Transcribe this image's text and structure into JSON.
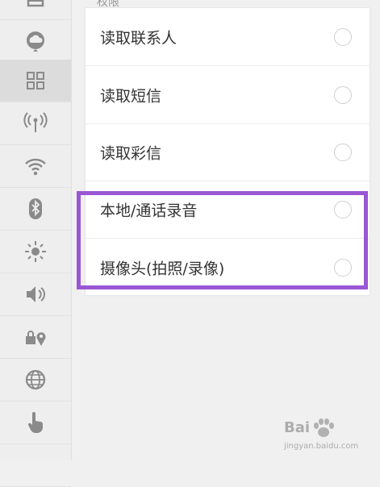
{
  "sidebar": {
    "items": [
      {
        "icon": "folder-icon"
      },
      {
        "icon": "cloud-sync-icon"
      },
      {
        "icon": "apps-grid-icon",
        "active": true
      },
      {
        "icon": "signal-tower-icon"
      },
      {
        "icon": "wifi-icon"
      },
      {
        "icon": "bluetooth-icon"
      },
      {
        "icon": "brightness-icon"
      },
      {
        "icon": "volume-icon"
      },
      {
        "icon": "location-lock-icon"
      },
      {
        "icon": "globe-icon"
      },
      {
        "icon": "touch-hand-icon"
      }
    ]
  },
  "section_label": "权限",
  "permissions": [
    {
      "label": "读取联系人",
      "enabled": false
    },
    {
      "label": "读取短信",
      "enabled": false
    },
    {
      "label": "读取彩信",
      "enabled": false
    },
    {
      "label": "本地/通话录音",
      "enabled": false
    },
    {
      "label": "摄像头(拍照/录像)",
      "enabled": false
    }
  ],
  "highlight_color": "#9a57d4",
  "watermark": {
    "text_main": "Bai",
    "text_sub": "jingyan.baidu.com"
  }
}
